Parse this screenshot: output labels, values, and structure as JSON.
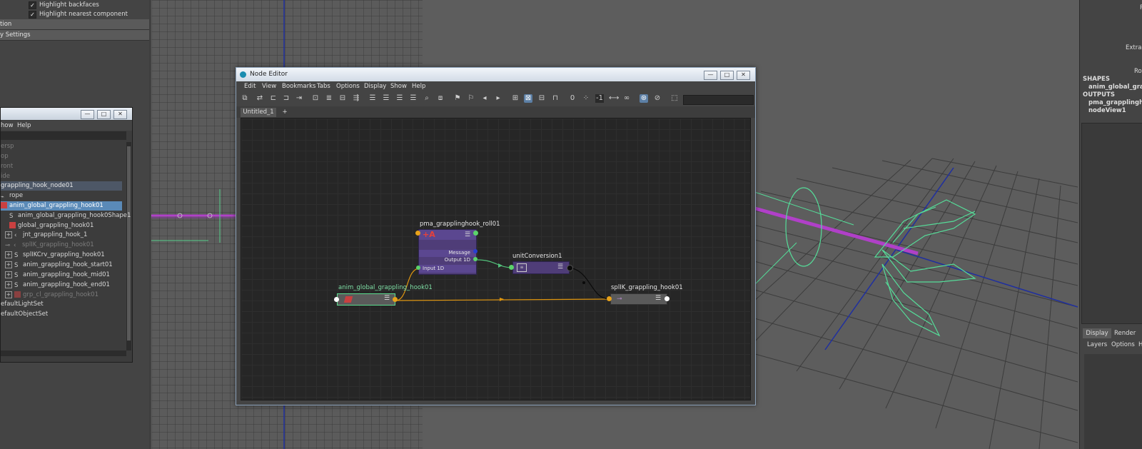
{
  "attribute_panel": {
    "checkboxes": [
      {
        "label": "Highlight backfaces",
        "checked": true
      },
      {
        "label": "Highlight nearest component",
        "checked": true
      }
    ],
    "frames": [
      "tion",
      "y Settings"
    ]
  },
  "outliner": {
    "menu": [
      "how",
      "Help"
    ],
    "window_buttons": [
      "—",
      "□",
      "✕"
    ],
    "items": [
      {
        "label": "ersp",
        "state": "dim"
      },
      {
        "label": "op",
        "state": "dim"
      },
      {
        "label": "ront",
        "state": "dim"
      },
      {
        "label": "ide",
        "state": "dim"
      },
      {
        "label": "grappling_hook_node01",
        "state": "group"
      },
      {
        "label": "rope",
        "state": "normal"
      },
      {
        "label": "anim_global_grappling_hook01",
        "state": "selected"
      },
      {
        "label": "anim_global_grappling_hook0Shape1",
        "state": "normal"
      },
      {
        "label": "global_grappling_hook01",
        "state": "normal"
      },
      {
        "label": "jnt_grappling_hook_1",
        "state": "normal"
      },
      {
        "label": "splIK_grappling_hook01",
        "state": "dim"
      },
      {
        "label": "splIKCrv_grappling_hook01",
        "state": "normal"
      },
      {
        "label": "anim_grappling_hook_start01",
        "state": "normal"
      },
      {
        "label": "anim_grappling_hook_mid01",
        "state": "normal"
      },
      {
        "label": "anim_grappling_hook_end01",
        "state": "normal"
      },
      {
        "label": "grp_cl_grappling_hook01",
        "state": "dim"
      },
      {
        "label": "efaultLightSet",
        "state": "normal"
      },
      {
        "label": "efaultObjectSet",
        "state": "normal"
      }
    ]
  },
  "node_editor": {
    "title": "Node Editor",
    "window_buttons": [
      "—",
      "□",
      "✕"
    ],
    "menu": [
      "Edit",
      "View",
      "Bookmarks",
      "Tabs",
      "Options",
      "Display",
      "Show",
      "Help"
    ],
    "tabs": [
      {
        "label": "Untitled_1",
        "active": true
      },
      {
        "label": "+",
        "active": false
      }
    ],
    "toolbar_readouts": [
      "0",
      "-1"
    ],
    "nodes": {
      "pma": {
        "name": "pma_grapplinghook_roll01",
        "ports": [
          "Message",
          "Output 1D",
          "Input 1D"
        ]
      },
      "unit": {
        "name": "unitConversion1"
      },
      "anim": {
        "name": "anim_global_grappling_hook01"
      },
      "splik": {
        "name": "splIK_grappling_hook01"
      }
    },
    "colors": {
      "pma_node": "#4f3d78",
      "unit_node": "#4f3d78",
      "plain_node": "#5a5a5a",
      "selected_outline": "#5cdd8f",
      "orange_wire": "#e0960f",
      "green_wire": "#52c07a"
    }
  },
  "right_panel": {
    "top_texts": [
      "R",
      "Extra C",
      "Rol"
    ],
    "sections": [
      {
        "header": "SHAPES",
        "items": [
          "anim_global_grappli"
        ]
      },
      {
        "header": "OUTPUTS",
        "items": [
          "pma_grapplinghook_",
          "nodeView1"
        ]
      }
    ],
    "tabs": [
      "Display",
      "Render"
    ],
    "submenu": [
      "Layers",
      "Options",
      "H"
    ]
  }
}
